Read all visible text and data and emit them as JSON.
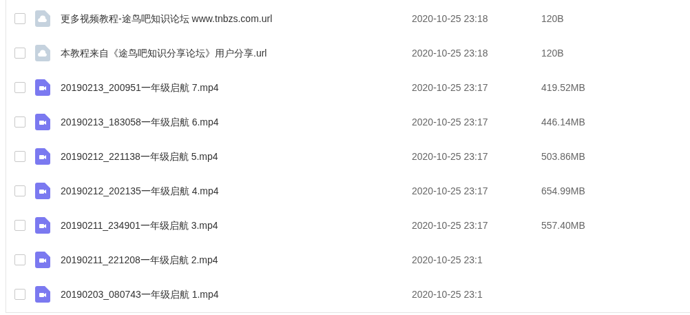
{
  "files": [
    {
      "kind": "link",
      "name": "更多视频教程-途鸟吧知识论坛 www.tnbzs.com.url",
      "date": "2020-10-25 23:18",
      "size": "120B",
      "checked": false
    },
    {
      "kind": "link",
      "name": "本教程来自《途鸟吧知识分享论坛》用户分享.url",
      "date": "2020-10-25 23:18",
      "size": "120B",
      "checked": false
    },
    {
      "kind": "video",
      "name": "20190213_200951一年级启航 7.mp4",
      "date": "2020-10-25 23:17",
      "size": "419.52MB",
      "checked": false
    },
    {
      "kind": "video",
      "name": "20190213_183058一年级启航 6.mp4",
      "date": "2020-10-25 23:17",
      "size": "446.14MB",
      "checked": false
    },
    {
      "kind": "video",
      "name": "20190212_221138一年级启航 5.mp4",
      "date": "2020-10-25 23:17",
      "size": "503.86MB",
      "checked": false
    },
    {
      "kind": "video",
      "name": "20190212_202135一年级启航 4.mp4",
      "date": "2020-10-25 23:17",
      "size": "654.99MB",
      "checked": false
    },
    {
      "kind": "video",
      "name": "20190211_234901一年级启航 3.mp4",
      "date": "2020-10-25 23:17",
      "size": "557.40MB",
      "checked": false
    },
    {
      "kind": "video",
      "name": "20190211_221208一年级启航 2.mp4",
      "date": "2020-10-25 23:1",
      "checked": false
    },
    {
      "kind": "video",
      "name": "20190203_080743一年级启航 1.mp4",
      "date": "2020-10-25 23:1",
      "checked": false
    }
  ]
}
